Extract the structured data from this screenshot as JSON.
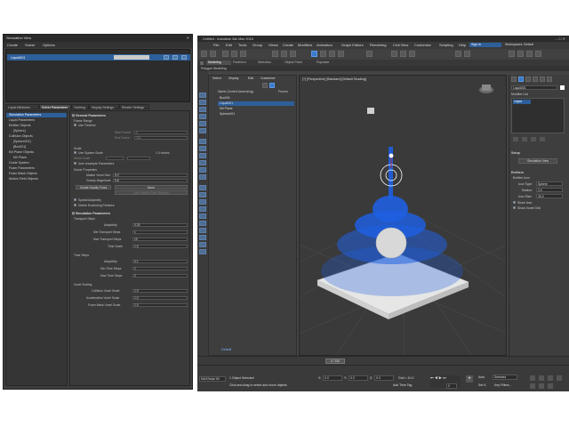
{
  "sim_view": {
    "title": "Simulation View",
    "menu": [
      "Create",
      "Solver",
      "Options"
    ],
    "liquid_name": "Liquid001",
    "tabs": [
      "Liquid Attributes",
      "Solver Parameters",
      "Caching",
      "Display Settings",
      "Render Settings"
    ],
    "tree": [
      "Simulation Parameters",
      "Liquid Parameters",
      "Emitter Objects",
      "[Sphere]",
      "Collision Objects",
      "[Sphere001]",
      "[Box001]",
      "Kill Plane Objects",
      "Kill Plane",
      "Guide System",
      "Foam Parameters",
      "Foam Mask Objects",
      "Motion Field Objects"
    ],
    "params": {
      "general_title": "General Parameters",
      "frame_range": "Frame Range",
      "use_timeline": "Use Timeline",
      "start_frame": "Start Frame:",
      "start_frame_val": "0",
      "end_frame": "End Frame:",
      "end_frame_val": "100",
      "scale": "Scale",
      "use_system_scale": "Use System Scale",
      "scale_val": "1.0 Inches",
      "real_world_scale": "World Scale",
      "auto_resample": "Auto resample Parameters",
      "solver_properties": "Solver Properties",
      "master_voxel": "Master Voxel Size",
      "master_voxel_val": "5.0",
      "gravity_mag": "Gravity Magnitude",
      "gravity_mag_val": "9.8",
      "create_gravity": "Create Gravity Force",
      "none_label": "None",
      "use_gravity_node": "Use Gravity Node Strength",
      "spatial_adaptivity": "Spatial Adaptivity",
      "delete_exceeding": "Delete Exceeding Particles",
      "sim_title": "Simulation Parameters",
      "transport_steps": "Transport Steps",
      "adaptivity": "Adaptivity",
      "adaptivity_val": "0.25",
      "min_transport": "Min Transport Steps",
      "min_transport_val": "1",
      "max_transport": "Max Transport Steps",
      "max_transport_val": "10",
      "time_scale": "Time Scale",
      "time_scale_val": "1.0",
      "time_steps": "Time Steps",
      "ts_adaptivity": "Adaptivity",
      "ts_adaptivity_val": "0.1",
      "min_time_steps": "Min Time Steps",
      "min_time_steps_val": "1",
      "max_time_steps": "Max Time Steps",
      "max_time_steps_val": "2",
      "voxel_scaling": "Voxel Scaling",
      "collision_voxel": "Collision Voxel Scale",
      "collision_voxel_val": "1.0",
      "accel_voxel": "Acceleration Voxel Scale",
      "accel_voxel_val": "1.0",
      "foam_mask_voxel": "Foam Mask Voxel Scale",
      "foam_mask_voxel_val": "1.0"
    }
  },
  "max": {
    "title": "Untitled - Autodesk 3ds Max 2018",
    "menu": [
      "File",
      "Edit",
      "Tools",
      "Group",
      "Views",
      "Create",
      "Modifiers",
      "Animation",
      "Graph Editors",
      "Rendering",
      "Civil View",
      "Customize",
      "Scripting",
      "Help"
    ],
    "user": "Sign In",
    "workspace": "Workspaces: Default",
    "ribbon_tabs": [
      "Modeling",
      "Freeform",
      "Selection",
      "Object Paint",
      "Populate"
    ],
    "ribbon_sub": "Polygon Modeling",
    "explorer_tabs": [
      "Select",
      "Display",
      "Edit",
      "Customize"
    ],
    "explorer_header": "Name (Sorted Ascending)",
    "explorer_header2": "Frozen",
    "explorer_items": [
      "Box001",
      "Liquid001",
      "Kill Plane",
      "Sphere001"
    ],
    "viewport_label": "[+] [Perspective] [Standard] [Default Shading]",
    "cmd": {
      "object_name": "Liquid001",
      "modifier_list": "Modifier List",
      "stack_item": "Liquid",
      "setup": "Setup",
      "sim_view_btn": "Simulation View",
      "emitters": "Emitters",
      "emitter_icon": "Emitter Icon",
      "icon_type": "Icon Type:",
      "icon_type_val": "Sphere",
      "radius": "Radius:",
      "radius_val": "3.0",
      "icon_size": "Icon Size:",
      "icon_size_val": "30.0",
      "show_icon": "Show Icon",
      "show_voxel_grid": "Show Voxel Grid"
    },
    "timeline": "0 / 100",
    "layer": "Default",
    "status": {
      "objects_selected": "1 Object Selected",
      "hint": "Click and drag to select and move objects",
      "maxscript": "MAXScript Mi",
      "x": "X:",
      "x_val": "0.0",
      "y": "Y:",
      "y_val": "0.0",
      "z": "Z:",
      "z_val": "0.0",
      "grid": "Grid = 10.0",
      "add_time_tag": "Add Time Tag",
      "auto": "Auto",
      "set_key": "Set K.",
      "selected": "Selected",
      "key_filters": "Key Filters...",
      "frame": "0"
    },
    "colors": {
      "accent": "#2d5f9a",
      "liquid": "#1f5fe0",
      "grid_line": "#555555"
    }
  }
}
